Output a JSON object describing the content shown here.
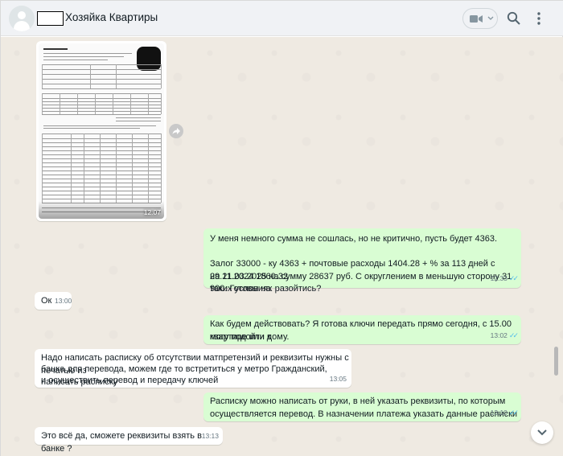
{
  "header": {
    "contact_name": "Хозяйка Квартиры"
  },
  "messages": [
    {
      "id": "msg1",
      "direction": "in",
      "type": "image",
      "time": "12:07"
    },
    {
      "id": "msg2",
      "direction": "out",
      "lines": [
        "У меня немного сумма не сошлась, но не критично, пусть будет 4363.",
        "",
        "Залог 33000 - ку 4363 + почтовые расходы 1404.28 + % за 113 дней с 29.11.2024 1860.32",
        "на 21.03.2025 на сумму 28637 руб. С округлением в меньшую сторону 31 900. Готовы на",
        "таких условиях разойтись?"
      ],
      "time": "12:33"
    },
    {
      "id": "msg3",
      "direction": "in",
      "lines": [
        "Ок"
      ],
      "time": "13:00"
    },
    {
      "id": "msg4",
      "direction": "out",
      "lines": [
        "Как будем действовать? Я готова ключи передать прямо сегодня, с 15.00 могу подойти к",
        "квартире или дому."
      ],
      "time": "13:02"
    },
    {
      "id": "msg5",
      "direction": "in",
      "lines": [
        "Надо написать расписку об отсутствии матпретензий и реквизиты нужны с печатью из",
        "банка для перевода, можем где то встретиться у метро Гражданский, написать расписку",
        "и осуществить перевод и передачу ключей"
      ],
      "time": "13:05"
    },
    {
      "id": "msg6",
      "direction": "out",
      "lines": [
        "Расписку можно написать от руки, в ней указать реквизиты, по которым",
        "осуществляется перевод. В назначении платежа указать данные расписки"
      ],
      "time": "13:10"
    },
    {
      "id": "msg7",
      "direction": "in",
      "lines": [
        "Это всё да, сможете реквизиты взять в банке ?"
      ],
      "time": "13:13"
    }
  ],
  "icons": {
    "video_call": "video-camera-icon",
    "search": "search-icon",
    "menu": "vertical-dots-menu-icon",
    "forward": "forward-arrow-icon",
    "scroll_down": "chevron-down-icon",
    "read_receipt": "double-check-icon"
  },
  "colors": {
    "header_bg": "#f0f2f5",
    "chat_bg": "#efeae2",
    "outgoing_bubble": "#d9fdd3",
    "incoming_bubble": "#ffffff",
    "read_ticks": "#53bdeb"
  }
}
